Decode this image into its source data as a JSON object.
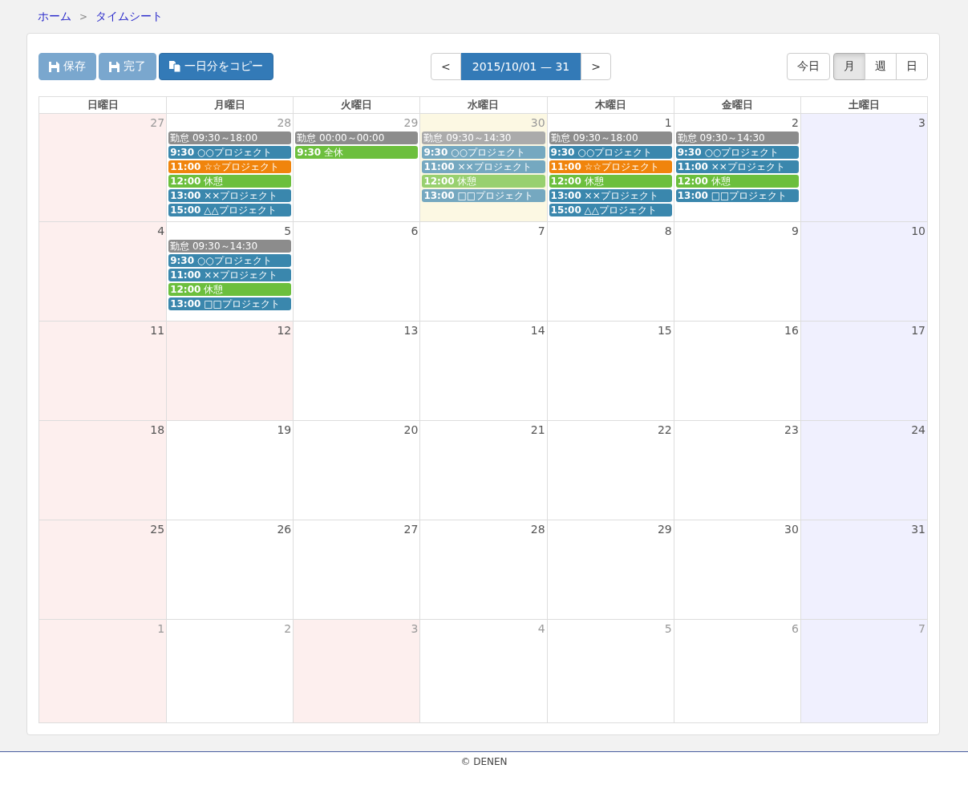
{
  "breadcrumb": [
    {
      "label": "ホーム"
    },
    {
      "separator": ">",
      "label": "タイムシート"
    }
  ],
  "toolbar": {
    "buttons": [
      {
        "kind": "save",
        "label": "保存",
        "disabled": true
      },
      {
        "kind": "save",
        "label": "完了",
        "disabled": true
      },
      {
        "kind": "copy",
        "label": "一日分をコピー",
        "disabled": false
      }
    ],
    "prev": "<",
    "range": "2015/10/01 — 31",
    "next": ">",
    "today": "今日",
    "views": [
      {
        "label": "月",
        "selected": true
      },
      {
        "label": "週",
        "selected": false
      },
      {
        "label": "日",
        "selected": false
      }
    ]
  },
  "weekdays": [
    "日曜日",
    "月曜日",
    "火曜日",
    "水曜日",
    "木曜日",
    "金曜日",
    "土曜日"
  ],
  "weeks": [
    [
      {
        "date": "27",
        "kind": "sunday",
        "other_month": true
      },
      {
        "date": "28",
        "kind": "weekday",
        "other_month": true,
        "events": [
          {
            "title": "勤怠 09:30～18:00",
            "color": "#8c8c8c"
          },
          {
            "time": "9:30",
            "title": "○○プロジェクト",
            "color": "#3a87ad"
          },
          {
            "time": "11:00",
            "title": "☆☆プロジェクト",
            "color": "#f0840c"
          },
          {
            "time": "12:00",
            "title": "休憩",
            "color": "#6cbf3d"
          },
          {
            "time": "13:00",
            "title": "××プロジェクト",
            "color": "#3a87ad"
          },
          {
            "time": "15:00",
            "title": "△△プロジェクト",
            "color": "#3a87ad"
          }
        ]
      },
      {
        "date": "29",
        "kind": "weekday",
        "other_month": true,
        "events": [
          {
            "title": "勤怠 00:00～00:00",
            "color": "#8c8c8c"
          },
          {
            "time": "9:30",
            "title": "全休",
            "color": "#6cbf3d"
          }
        ]
      },
      {
        "date": "30",
        "kind": "today",
        "other_month": true,
        "events": [
          {
            "title": "勤怠 09:30～14:30",
            "color": "#ababab"
          },
          {
            "time": "9:30",
            "title": "○○プロジェクト",
            "color": "#75a8c0"
          },
          {
            "time": "11:00",
            "title": "××プロジェクト",
            "color": "#75a8c0"
          },
          {
            "time": "12:00",
            "title": "休憩",
            "color": "#98d06f"
          },
          {
            "time": "13:00",
            "title": "□□プロジェクト",
            "color": "#75a8c0"
          }
        ]
      },
      {
        "date": "1",
        "kind": "weekday",
        "other_month": false,
        "events": [
          {
            "title": "勤怠 09:30～18:00",
            "color": "#8c8c8c"
          },
          {
            "time": "9:30",
            "title": "○○プロジェクト",
            "color": "#3a87ad"
          },
          {
            "time": "11:00",
            "title": "☆☆プロジェクト",
            "color": "#f0840c"
          },
          {
            "time": "12:00",
            "title": "休憩",
            "color": "#6cbf3d"
          },
          {
            "time": "13:00",
            "title": "××プロジェクト",
            "color": "#3a87ad"
          },
          {
            "time": "15:00",
            "title": "△△プロジェクト",
            "color": "#3a87ad"
          }
        ]
      },
      {
        "date": "2",
        "kind": "weekday",
        "other_month": false,
        "events": [
          {
            "title": "勤怠 09:30～14:30",
            "color": "#8c8c8c"
          },
          {
            "time": "9:30",
            "title": "○○プロジェクト",
            "color": "#3a87ad"
          },
          {
            "time": "11:00",
            "title": "××プロジェクト",
            "color": "#3a87ad"
          },
          {
            "time": "12:00",
            "title": "休憩",
            "color": "#6cbf3d"
          },
          {
            "time": "13:00",
            "title": "□□プロジェクト",
            "color": "#3a87ad"
          }
        ]
      },
      {
        "date": "3",
        "kind": "saturday",
        "other_month": false
      }
    ],
    [
      {
        "date": "4",
        "kind": "sunday",
        "other_month": false
      },
      {
        "date": "5",
        "kind": "weekday",
        "other_month": false,
        "events": [
          {
            "title": "勤怠 09:30～14:30",
            "color": "#8c8c8c"
          },
          {
            "time": "9:30",
            "title": "○○プロジェクト",
            "color": "#3a87ad"
          },
          {
            "time": "11:00",
            "title": "××プロジェクト",
            "color": "#3a87ad"
          },
          {
            "time": "12:00",
            "title": "休憩",
            "color": "#6cbf3d"
          },
          {
            "time": "13:00",
            "title": "□□プロジェクト",
            "color": "#3a87ad"
          }
        ]
      },
      {
        "date": "6",
        "kind": "weekday",
        "other_month": false
      },
      {
        "date": "7",
        "kind": "weekday",
        "other_month": false
      },
      {
        "date": "8",
        "kind": "weekday",
        "other_month": false
      },
      {
        "date": "9",
        "kind": "weekday",
        "other_month": false
      },
      {
        "date": "10",
        "kind": "saturday",
        "other_month": false
      }
    ],
    [
      {
        "date": "11",
        "kind": "sunday",
        "other_month": false
      },
      {
        "date": "12",
        "kind": "holiday",
        "other_month": false
      },
      {
        "date": "13",
        "kind": "weekday",
        "other_month": false
      },
      {
        "date": "14",
        "kind": "weekday",
        "other_month": false
      },
      {
        "date": "15",
        "kind": "weekday",
        "other_month": false
      },
      {
        "date": "16",
        "kind": "weekday",
        "other_month": false
      },
      {
        "date": "17",
        "kind": "saturday",
        "other_month": false
      }
    ],
    [
      {
        "date": "18",
        "kind": "sunday",
        "other_month": false
      },
      {
        "date": "19",
        "kind": "weekday",
        "other_month": false
      },
      {
        "date": "20",
        "kind": "weekday",
        "other_month": false
      },
      {
        "date": "21",
        "kind": "weekday",
        "other_month": false
      },
      {
        "date": "22",
        "kind": "weekday",
        "other_month": false
      },
      {
        "date": "23",
        "kind": "weekday",
        "other_month": false
      },
      {
        "date": "24",
        "kind": "saturday",
        "other_month": false
      }
    ],
    [
      {
        "date": "25",
        "kind": "sunday",
        "other_month": false
      },
      {
        "date": "26",
        "kind": "weekday",
        "other_month": false
      },
      {
        "date": "27",
        "kind": "weekday",
        "other_month": false
      },
      {
        "date": "28",
        "kind": "weekday",
        "other_month": false
      },
      {
        "date": "29",
        "kind": "weekday",
        "other_month": false
      },
      {
        "date": "30",
        "kind": "weekday",
        "other_month": false
      },
      {
        "date": "31",
        "kind": "saturday",
        "other_month": false
      }
    ],
    [
      {
        "date": "1",
        "kind": "sunday",
        "other_month": true
      },
      {
        "date": "2",
        "kind": "weekday",
        "other_month": true
      },
      {
        "date": "3",
        "kind": "holiday",
        "other_month": true
      },
      {
        "date": "4",
        "kind": "weekday",
        "other_month": true
      },
      {
        "date": "5",
        "kind": "weekday",
        "other_month": true
      },
      {
        "date": "6",
        "kind": "weekday",
        "other_month": true
      },
      {
        "date": "7",
        "kind": "saturday",
        "other_month": true
      }
    ]
  ],
  "footer": "© DENEN"
}
